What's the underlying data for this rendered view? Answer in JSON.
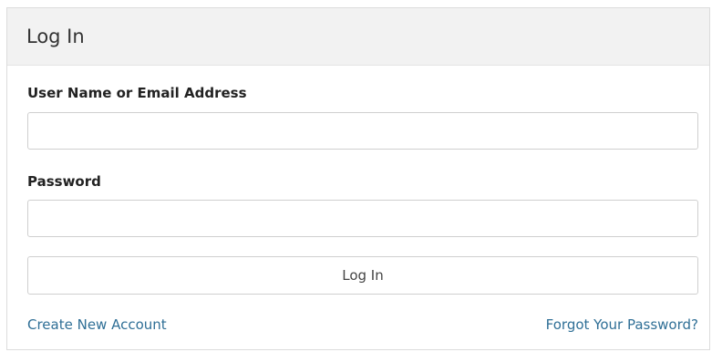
{
  "panel": {
    "title": "Log In"
  },
  "form": {
    "username_label": "User Name or Email Address",
    "username_value": "",
    "password_label": "Password",
    "password_value": "",
    "submit_label": "Log In"
  },
  "links": {
    "create_account": "Create New Account",
    "forgot_password": "Forgot Your Password?"
  },
  "colors": {
    "link": "#2f6f96",
    "header_bg": "#f2f2f2",
    "border": "#cfcfcf"
  }
}
